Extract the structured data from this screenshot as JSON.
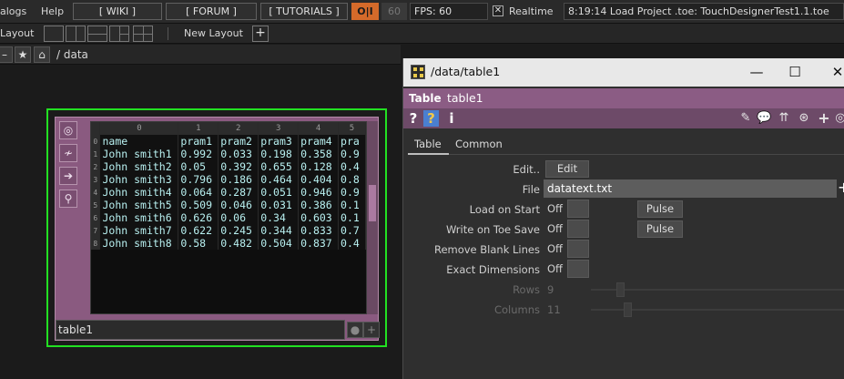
{
  "menu": {
    "dialogs": "alogs",
    "help": "Help",
    "wiki": "[ WIKI ]",
    "forum": "[ FORUM ]",
    "tutorials": "[ TUTORIALS ]",
    "oi": "O|I",
    "fps_value": "60",
    "fps_display": "FPS:  60",
    "realtime_check": "✕",
    "realtime_label": "Realtime",
    "status": "8:19:14 Load Project .toe: TouchDesignerTest1.1.toe"
  },
  "layoutbar": {
    "label": "Layout",
    "new_layout": "New Layout",
    "plus": "+"
  },
  "pathbar": {
    "back": "–",
    "star": "★",
    "home": "⌂",
    "path": "/ data"
  },
  "node": {
    "name": "table1",
    "side_icons": [
      "◎",
      "≁",
      "➔",
      "⚲"
    ],
    "dot_button": "●",
    "plus_button": "+",
    "columns": [
      "0",
      "1",
      "2",
      "3",
      "4",
      "5"
    ],
    "row_index": [
      "0",
      "1",
      "2",
      "3",
      "4",
      "5",
      "6",
      "7",
      "8"
    ],
    "rows": [
      [
        "name",
        "pram1",
        "pram2",
        "pram3",
        "pram4",
        "pra"
      ],
      [
        "John smith1",
        "0.992",
        "0.033",
        "0.198",
        "0.358",
        "0.9"
      ],
      [
        "John smith2",
        "0.05",
        "0.392",
        "0.655",
        "0.128",
        "0.4"
      ],
      [
        "John smith3",
        "0.796",
        "0.186",
        "0.464",
        "0.404",
        "0.8"
      ],
      [
        "John smith4",
        "0.064",
        "0.287",
        "0.051",
        "0.946",
        "0.9"
      ],
      [
        "John smith5",
        "0.509",
        "0.046",
        "0.031",
        "0.386",
        "0.1"
      ],
      [
        "John smith6",
        "0.626",
        "0.06",
        "0.34",
        "0.603",
        "0.1"
      ],
      [
        "John smith7",
        "0.622",
        "0.245",
        "0.344",
        "0.833",
        "0.7"
      ],
      [
        "John smith8",
        "0.58",
        "0.482",
        "0.504",
        "0.837",
        "0.4"
      ]
    ]
  },
  "param_window": {
    "title": "/data/table1",
    "minimize": "—",
    "maximize": "☐",
    "close": "✕",
    "type_label": "Table",
    "node_name": "table1",
    "tool_help": "?",
    "tool_help2": "?",
    "tool_info": "i",
    "right_icons": [
      "✎",
      "💬",
      "⇈",
      "⊛",
      "+",
      "◎"
    ],
    "tabs": [
      "Table",
      "Common"
    ],
    "params": {
      "edit_label": "Edit..",
      "edit_button": "Edit",
      "file_label": "File",
      "file_value": "datatext.txt",
      "file_plus": "+",
      "load_label": "Load on Start",
      "load_value": "Off",
      "write_label": "Write on Toe Save",
      "write_value": "Off",
      "pulse": "Pulse",
      "blank_label": "Remove Blank Lines",
      "blank_value": "Off",
      "exact_label": "Exact Dimensions",
      "exact_value": "Off",
      "rows_label": "Rows",
      "rows_value": "9",
      "rows_fraction": 0.1,
      "cols_label": "Columns",
      "cols_value": "11",
      "cols_fraction": 0.13
    }
  }
}
